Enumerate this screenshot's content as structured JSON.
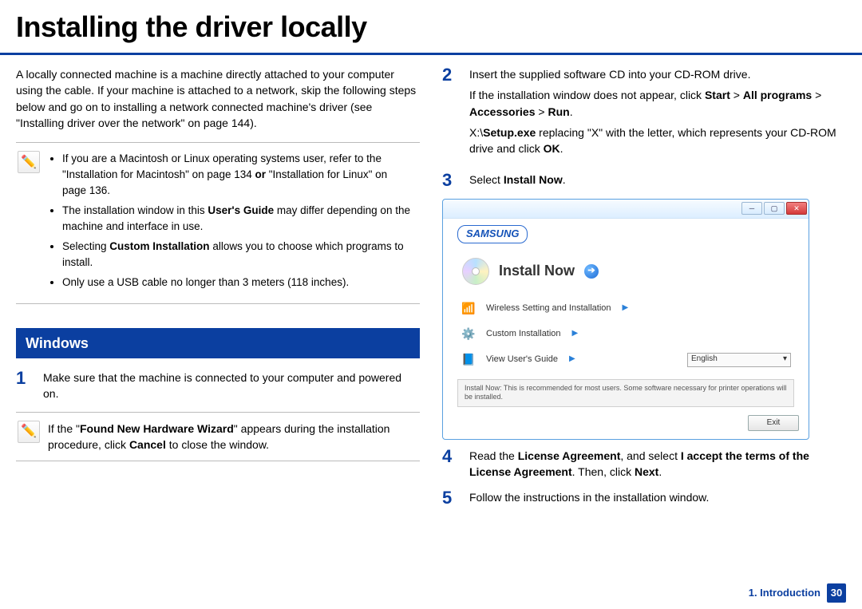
{
  "title": "Installing the driver locally",
  "intro": "A locally connected machine is a machine directly attached to your computer using the cable. If your machine is attached to a network, skip the following steps below and go on to installing a network connected machine's driver (see \"Installing driver over the network\" on page 144).",
  "note1": {
    "items": [
      {
        "pre": "If you are a Macintosh or Linux operating systems user, refer to the \"Installation for Macintosh\" on page 134 ",
        "bold": "or",
        "post": " \"Installation for Linux\" on page 136."
      },
      {
        "pre": "The installation window in this ",
        "bold": "User's Guide",
        "post": " may differ depending on the machine and interface in use."
      },
      {
        "pre": "Selecting ",
        "bold": "Custom Installation",
        "post": " allows you to choose which programs to install."
      },
      {
        "pre": "Only use a USB cable no longer than 3 meters (118 inches).",
        "bold": "",
        "post": ""
      }
    ]
  },
  "subheader": "Windows",
  "step1": {
    "num": "1",
    "text": "Make sure that the machine is connected to your computer and powered on."
  },
  "note2": {
    "pre": "If the \"",
    "b1": "Found New Hardware Wizard",
    "mid": "\" appears during the installation procedure, click ",
    "b2": "Cancel",
    "post": " to close the window."
  },
  "step2": {
    "num": "2",
    "p1": "Insert the supplied software CD into your CD-ROM drive.",
    "p2a": "If the installation window does not appear, click ",
    "p2b1": "Start",
    "gt1": " > ",
    "p2b2": "All programs",
    "gt2": " > ",
    "p2b3": "Accessories",
    "gt3": " > ",
    "p2b4": "Run",
    "p2end": ".",
    "p3a": " X:\\",
    "p3b": "Setup.exe",
    "p3c": " replacing \"X\" with the letter, which represents your CD-ROM drive and click ",
    "p3d": "OK",
    "p3e": "."
  },
  "step3": {
    "num": "3",
    "pre": "Select ",
    "bold": "Install Now",
    "post": "."
  },
  "dialog": {
    "brand": "SAMSUNG",
    "installNow": "Install Now",
    "wireless": "Wireless Setting and Installation",
    "custom": "Custom Installation",
    "guide": "View User's Guide",
    "lang": "English",
    "info": "Install Now: This is recommended for most users. Some software necessary for printer operations will be installed.",
    "exit": "Exit"
  },
  "step4": {
    "num": "4",
    "pre": "Read the ",
    "b1": "License Agreement",
    "mid1": ", and select ",
    "b2": "I accept the terms of the License Agreement",
    "mid2": ". Then, click ",
    "b3": "Next",
    "post": "."
  },
  "step5": {
    "num": "5",
    "text": "Follow the instructions in the installation window."
  },
  "footer": {
    "chapter": "1.  Introduction",
    "page": "30"
  }
}
